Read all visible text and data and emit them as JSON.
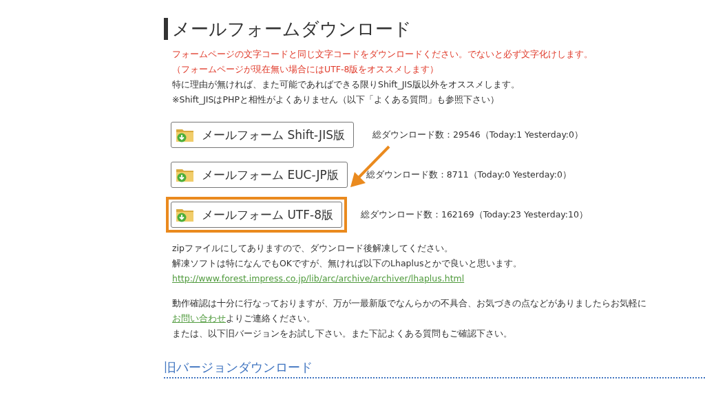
{
  "heading": "メールフォームダウンロード",
  "notices": [
    {
      "text": "フォームページの文字コードと同じ文字コードをダウンロードください。でないと必ず文字化けします。",
      "kind": "warning"
    },
    {
      "text": "（フォームページが現在無い場合にはUTF-8版をオススメします）",
      "kind": "warning"
    },
    {
      "text": "特に理由が無ければ、また可能であればできる限りShift_JIS版以外をオススメします。",
      "kind": "normal"
    },
    {
      "text": "※Shift_JISはPHPと相性がよくありません（以下「よくある質問」も参照下さい）",
      "kind": "normal"
    }
  ],
  "downloads": [
    {
      "label": "メールフォーム Shift-JIS版",
      "count": "総ダウンロード数：29546（Today:1 Yesterday:0）",
      "highlighted": false
    },
    {
      "label": "メールフォーム EUC-JP版",
      "count": "総ダウンロード数：8711（Today:0 Yesterday:0）",
      "highlighted": false
    },
    {
      "label": "メールフォーム UTF-8版",
      "count": "総ダウンロード数：162169（Today:23 Yesterday:10）",
      "highlighted": true
    }
  ],
  "unzip_lines": [
    "zipファイルにしてありますので、ダウンロード後解凍してください。",
    "解凍ソフトは特になんでもOKですが、無ければ以下のLhaplusとかで良いと思います。"
  ],
  "unzip_link": "http://www.forest.impress.co.jp/lib/arc/archive/archiver/lhaplus.html",
  "contact": {
    "before": "動作確認は十分に行なっておりますが、万が一最新版でなんらかの不具合、お気づきの点などがありましたらお気軽に",
    "link": "お問い合わせ",
    "after": "よりご連絡ください。"
  },
  "older_note": "または、以下旧バージョンをお試し下さい。また下記よくある質問もご確認下さい。",
  "section_heading": "旧バージョンダウンロード"
}
